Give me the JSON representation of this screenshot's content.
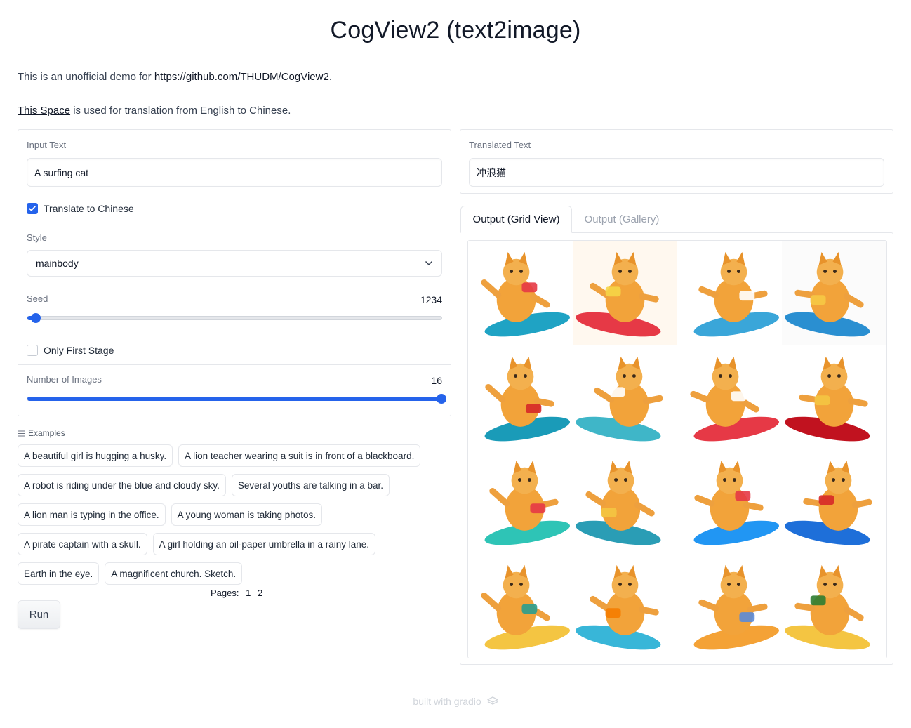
{
  "title": "CogView2 (text2image)",
  "description": {
    "line1_prefix": "This is an unofficial demo for ",
    "line1_link": "https://github.com/THUDM/CogView2",
    "line1_suffix": ".",
    "line2_link": "This Space",
    "line2_suffix": " is used for translation from English to Chinese."
  },
  "input_text": {
    "label": "Input Text",
    "value": "A surfing cat"
  },
  "translate": {
    "label": "Translate to Chinese",
    "checked": true
  },
  "style": {
    "label": "Style",
    "value": "mainbody"
  },
  "seed": {
    "label": "Seed",
    "value": "1234",
    "fraction": 0.02
  },
  "only_first_stage": {
    "label": "Only First Stage",
    "checked": false
  },
  "num_images": {
    "label": "Number of Images",
    "value": "16",
    "fraction": 1.0
  },
  "translated_text": {
    "label": "Translated Text",
    "value": "冲浪猫"
  },
  "examples": {
    "header": "Examples",
    "items": [
      "A beautiful girl is hugging a husky.",
      "A lion teacher wearing a suit is in front of a blackboard.",
      "A robot is riding under the blue and cloudy sky.",
      "Several youths are talking in a bar.",
      "A lion man is typing in the office.",
      "A young woman is taking photos.",
      "A pirate captain with a skull.",
      "A girl holding an oil-paper umbrella in a rainy lane.",
      "Earth in the eye.",
      "A magnificent church. Sketch."
    ],
    "pages_label": "Pages:",
    "pages": [
      "1",
      "2"
    ]
  },
  "run_label": "Run",
  "tabs": [
    {
      "label": "Output (Grid View)",
      "active": true
    },
    {
      "label": "Output (Gallery)",
      "active": false
    }
  ],
  "output_images_count": 16,
  "footer": "built with gradio",
  "colors": {
    "accent": "#2563eb",
    "border": "#e5e7eb",
    "cat": "#f2a33a"
  }
}
